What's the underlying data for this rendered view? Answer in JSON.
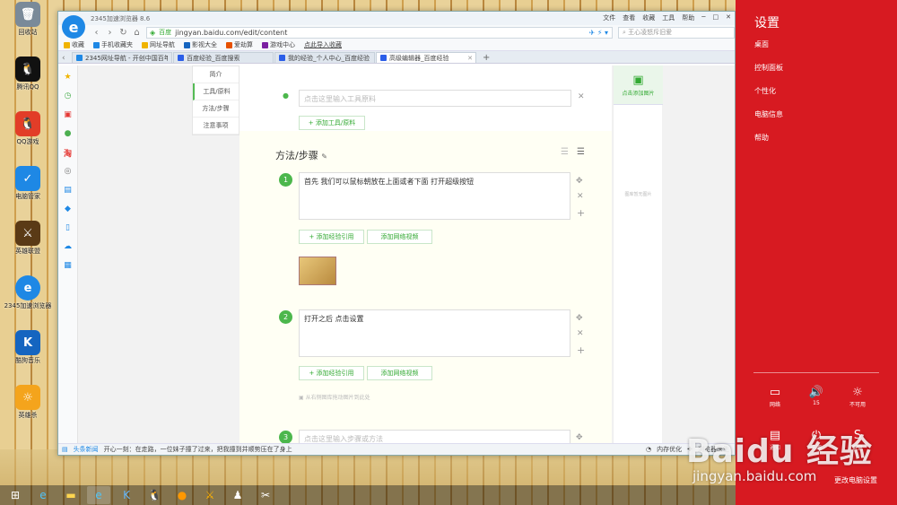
{
  "desktop": {
    "icons": [
      {
        "label": "回收站",
        "icon": "recycle-bin-icon",
        "color": "#7a8a99",
        "glyph": "🗑"
      },
      {
        "label": "腾讯QQ",
        "icon": "qq-icon",
        "color": "#111111",
        "glyph": "🐧"
      },
      {
        "label": "QQ游戏",
        "icon": "qq-game-icon",
        "color": "#e23d28",
        "glyph": "🐧"
      },
      {
        "label": "电脑管家",
        "icon": "pc-manager-icon",
        "color": "#1e88e5",
        "glyph": "✓"
      },
      {
        "label": "英雄联盟",
        "icon": "lol-icon",
        "color": "#5a3a16",
        "glyph": "⚔"
      },
      {
        "label": "2345加速浏览器",
        "icon": "browser-icon",
        "color": "#1e88e5",
        "glyph": "e"
      },
      {
        "label": "酷狗音乐",
        "icon": "kugou-icon",
        "color": "#1565c0",
        "glyph": "K"
      },
      {
        "label": "英雄杀",
        "icon": "yingxiongsha-icon",
        "color": "#f4a41c",
        "glyph": "☼"
      }
    ]
  },
  "browser": {
    "title": "2345加速浏览器 8.6",
    "menu": [
      "文件",
      "查看",
      "收藏",
      "工具",
      "帮助"
    ],
    "address": {
      "tag": "百度",
      "url": "jingyan.baidu.com/edit/content"
    },
    "search_placeholder": "王心凌怒斥旧爱",
    "favorites": [
      {
        "label": "收藏",
        "color": "#f0b400"
      },
      {
        "label": "手机收藏夹",
        "color": "#1e88e5"
      },
      {
        "label": "网址导航",
        "color": "#f0b400"
      },
      {
        "label": "影视大全",
        "color": "#1565c0"
      },
      {
        "label": "爱劫算",
        "color": "#e65100"
      },
      {
        "label": "游戏中心",
        "color": "#7b1fa2"
      },
      {
        "label": "点此导入收藏",
        "color": "#ffffff"
      }
    ],
    "tabs": [
      {
        "label": "2345网址导航 - 开创中国百年品牌",
        "active": false
      },
      {
        "label": "百度经验_百度搜索",
        "active": false
      },
      {
        "label": "我的经验_个人中心_百度经验",
        "active": false
      },
      {
        "label": "高级编辑器_百度经验",
        "active": true
      }
    ],
    "status": {
      "news": "头条新闻",
      "ticker": "开心一刻：在走路，一位妹子撞了过来，把我撞到并顺势压在了身上",
      "mem": "内存优化",
      "doctor": "浏览器医生"
    }
  },
  "editor": {
    "section_nav": [
      "简介",
      "工具/原料",
      "方法/步骤",
      "注意事项"
    ],
    "tool_placeholder": "点击这里输入工具原料",
    "add_tool": "+ 添加工具/原料",
    "methods_title": "方法/步骤",
    "steps": [
      {
        "num": "1",
        "text": "首先 我们可以鼠标朝放在上面或者下面 打开超级按钮"
      },
      {
        "num": "2",
        "text": "打开之后 点击设置"
      },
      {
        "num": "3",
        "text": "点击这里输入步骤或方法"
      }
    ],
    "add_quote": "+ 添加经验引用",
    "add_video": "添加网络视频",
    "drag_hint": "从右侧图库拖动图片到此处",
    "add_image": "点击添加图片",
    "no_image": "图库暂无图片"
  },
  "charms": {
    "title": "设置",
    "items": [
      "桌面",
      "控制面板",
      "个性化",
      "电脑信息",
      "帮助"
    ],
    "settings": [
      {
        "label": "网络",
        "icon": "network-icon",
        "glyph": "▭"
      },
      {
        "label": "15",
        "icon": "volume-icon",
        "glyph": "🔊"
      },
      {
        "label": "不可用",
        "icon": "brightness-icon",
        "glyph": "☼"
      },
      {
        "label": "通知",
        "icon": "notifications-icon",
        "glyph": "▤"
      },
      {
        "label": "电源",
        "icon": "power-icon",
        "glyph": "⏻"
      },
      {
        "label": "键盘",
        "icon": "keyboard-icon",
        "glyph": "S"
      }
    ],
    "change_settings": "更改电脑设置"
  },
  "watermark": {
    "logo": "Baidu 经验",
    "url": "jingyan.baidu.com"
  }
}
